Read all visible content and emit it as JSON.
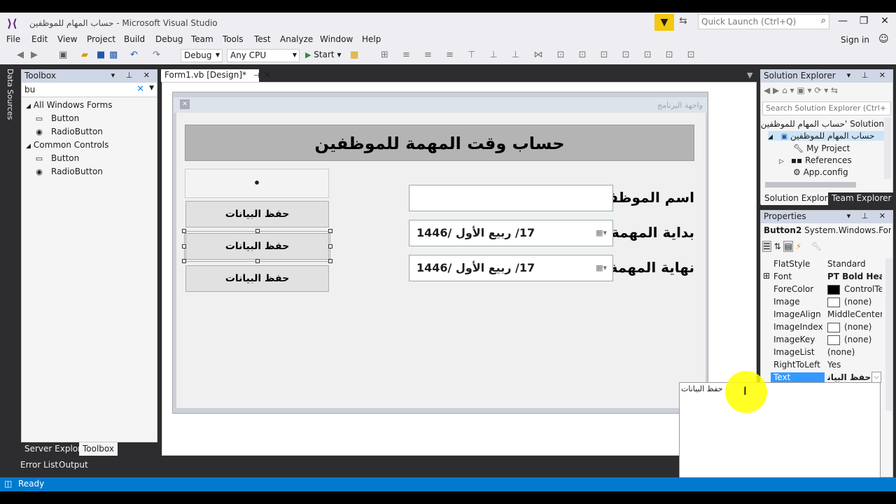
{
  "window": {
    "title": "حساب المهام للموظفين - Microsoft Visual Studio",
    "quick_launch_placeholder": "Quick Launch (Ctrl+Q)",
    "sign_in": "Sign in"
  },
  "menu": [
    "File",
    "Edit",
    "View",
    "Project",
    "Build",
    "Debug",
    "Team",
    "Tools",
    "Test",
    "Analyze",
    "Window",
    "Help"
  ],
  "toolbar": {
    "config": "Debug",
    "platform": "Any CPU",
    "start": "Start"
  },
  "left_rail": {
    "data_sources": "Data Sources"
  },
  "toolbox": {
    "title": "Toolbox",
    "search_value": "bu",
    "groups": [
      {
        "name": "All Windows Forms",
        "items": [
          "Button",
          "RadioButton"
        ]
      },
      {
        "name": "Common Controls",
        "items": [
          "Button",
          "RadioButton"
        ]
      }
    ]
  },
  "bottom_tabs": {
    "server_explorer": "Server Explorer",
    "toolbox": "Toolbox",
    "error_list": "Error List",
    "output": "Output"
  },
  "designer": {
    "tab": "Form1.vb [Design]*",
    "form_caption": "واجهة البرنامج",
    "heading": "حساب وقت المهمة للموظفين",
    "label_employee": "اسم الموظف:",
    "label_start": "بداية المهمة:",
    "label_end": "نهاية المهمة:",
    "date_start": "17/   ربيع الأول   /1446",
    "date_end": "17/   ربيع الأول   /1446",
    "top_button_text": "•",
    "button_save_1": "حفظ البيانات",
    "button_save_2": "حفظ البيانات",
    "button_save_3": "حفظ البيانات"
  },
  "solution_explorer": {
    "title": "Solution Explorer",
    "search_placeholder": "Search Solution Explorer (Ctrl+",
    "solution": "Solution 'حساب المهام للموظفين",
    "project": "حساب المهام للموظفين",
    "my_project": "My Project",
    "references": "References",
    "app_config": "App.config",
    "tab_solution": "Solution Explorer",
    "tab_team": "Team Explorer"
  },
  "properties": {
    "title": "Properties",
    "object": "Button2",
    "object_type": "System.Windows.Forms.",
    "rows": [
      {
        "name": "FlatStyle",
        "value": "Standard"
      },
      {
        "name": "Font",
        "value": "PT Bold Headin"
      },
      {
        "name": "ForeColor",
        "value": "ControlTex"
      },
      {
        "name": "Image",
        "value": "(none)"
      },
      {
        "name": "ImageAlign",
        "value": "MiddleCenter"
      },
      {
        "name": "ImageIndex",
        "value": "(none)"
      },
      {
        "name": "ImageKey",
        "value": "(none)"
      },
      {
        "name": "ImageList",
        "value": "(none)"
      },
      {
        "name": "RightToLeft",
        "value": "Yes"
      },
      {
        "name": "Text",
        "value": "حفظ البيانات"
      }
    ],
    "text_editor_value": "حفظ البيانات"
  },
  "status": {
    "text": "Ready"
  },
  "colors": {
    "accent": "#007acc",
    "highlight": "#3399ff",
    "filter_yellow": "#f2c811"
  }
}
